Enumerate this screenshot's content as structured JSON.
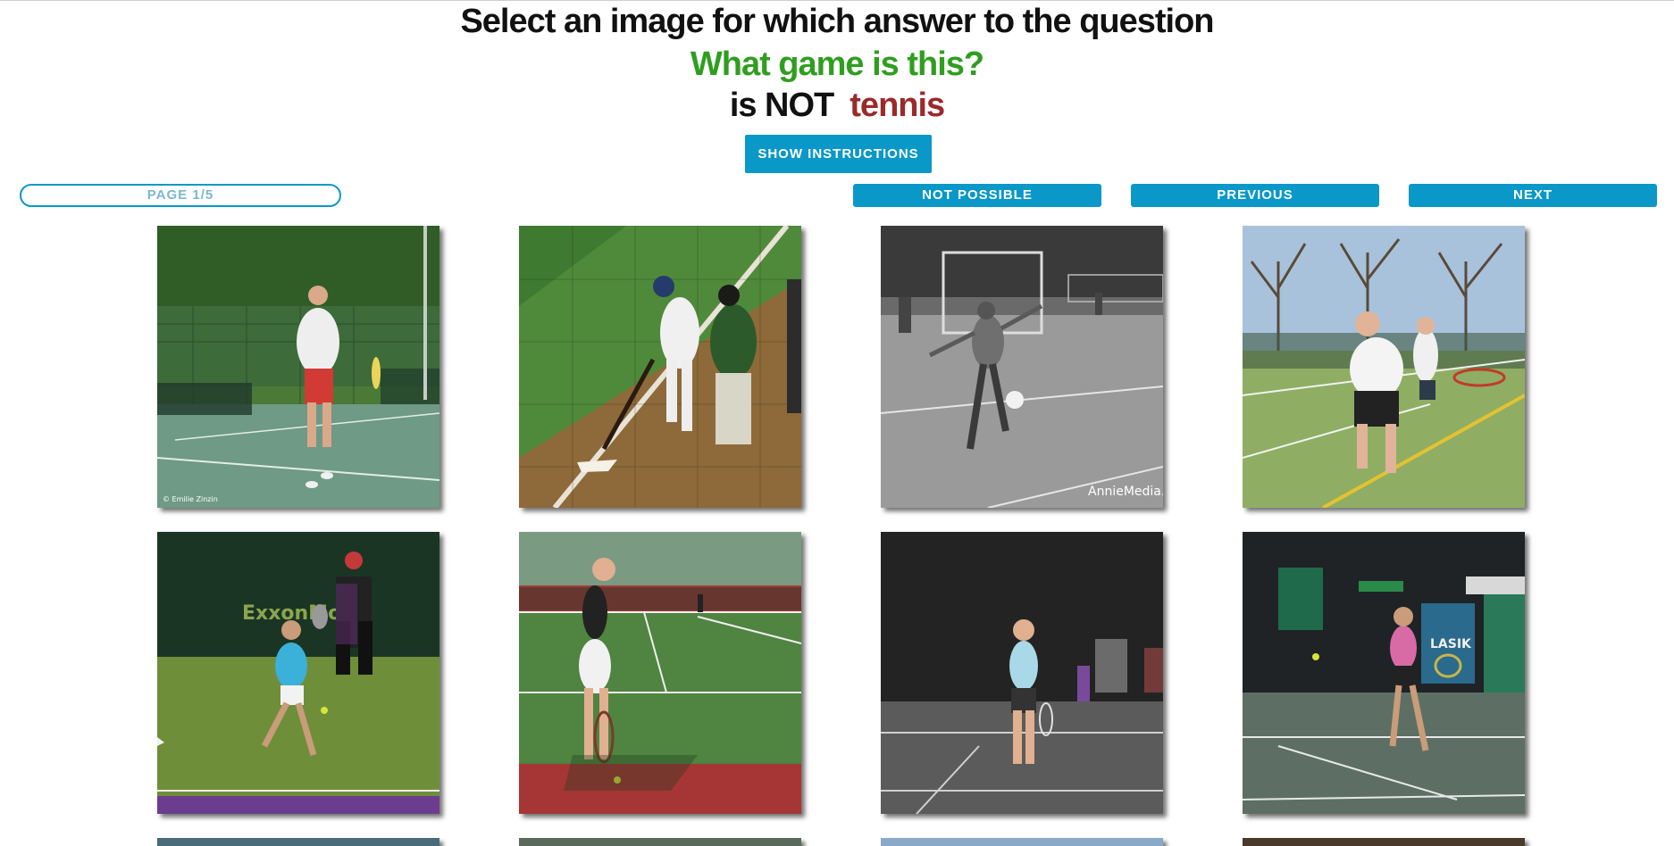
{
  "header": {
    "line1": "Select an image for which answer to the question",
    "question": "What game is this?",
    "is_not": "is NOT",
    "answer": "tennis"
  },
  "controls": {
    "show_instructions": "SHOW INSTRUCTIONS",
    "page": "PAGE 1/5",
    "not_possible": "NOT POSSIBLE",
    "previous": "PREVIOUS",
    "next": "NEXT"
  },
  "images": [
    {
      "name": "man-walking-on-tennis-court-image",
      "watermark": "© Emilie Zinzin"
    },
    {
      "name": "baseball-batter-and-catcher-image",
      "watermark": ""
    },
    {
      "name": "black-white-soccer-kick-image",
      "watermark": "AnnieMedia.nl"
    },
    {
      "name": "boy-swinging-racket-on-field-image",
      "watermark": ""
    },
    {
      "name": "tennis-player-forehand-exxonmobil-image",
      "watermark": "ExxonMobil"
    },
    {
      "name": "woman-tennis-serve-prep-image",
      "watermark": ""
    },
    {
      "name": "woman-standing-on-clay-court-image",
      "watermark": ""
    },
    {
      "name": "woman-tennis-forehand-indoor-image",
      "watermark": "LASIK"
    },
    {
      "name": "partial-row-image-1",
      "watermark": ""
    },
    {
      "name": "partial-row-image-2",
      "watermark": ""
    },
    {
      "name": "partial-row-image-3",
      "watermark": ""
    },
    {
      "name": "partial-row-image-4",
      "watermark": ""
    }
  ],
  "colors": {
    "accent": "#0a98c8",
    "question": "#2f9e1f",
    "answer": "#9b2a2a"
  }
}
